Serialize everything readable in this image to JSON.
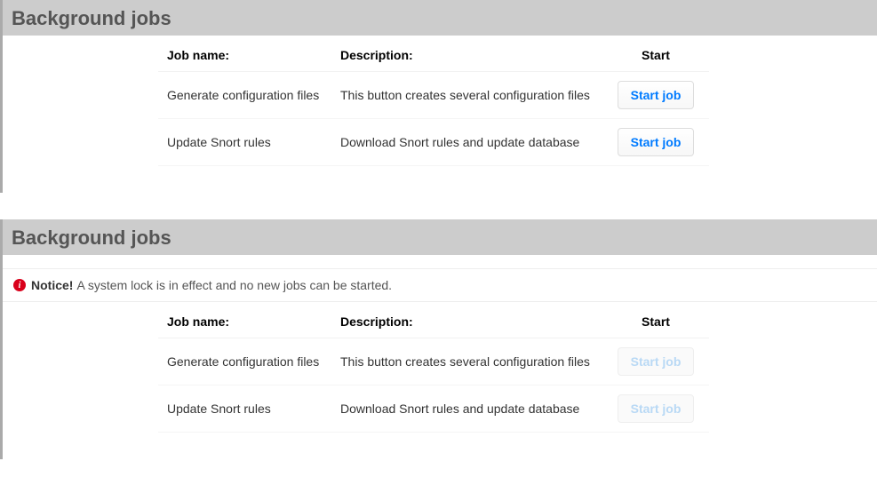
{
  "colors": {
    "accent": "#007bff",
    "header_bg": "#cccccc",
    "border_left": "#aaaaaa",
    "alert_icon": "#d9001b"
  },
  "sections": [
    {
      "title": "Background jobs",
      "notice": null,
      "columns": {
        "name": "Job name:",
        "description": "Description:",
        "start": "Start"
      },
      "button_label": "Start job",
      "jobs": [
        {
          "name": "Generate configuration files",
          "description": "This button creates several configuration files",
          "enabled": true
        },
        {
          "name": "Update Snort rules",
          "description": "Download Snort rules and update database",
          "enabled": true
        }
      ]
    },
    {
      "title": "Background jobs",
      "notice": {
        "strong": "Notice!",
        "text": "A system lock is in effect and no new jobs can be started."
      },
      "columns": {
        "name": "Job name:",
        "description": "Description:",
        "start": "Start"
      },
      "button_label": "Start job",
      "jobs": [
        {
          "name": "Generate configuration files",
          "description": "This button creates several configuration files",
          "enabled": false
        },
        {
          "name": "Update Snort rules",
          "description": "Download Snort rules and update database",
          "enabled": false
        }
      ]
    }
  ]
}
